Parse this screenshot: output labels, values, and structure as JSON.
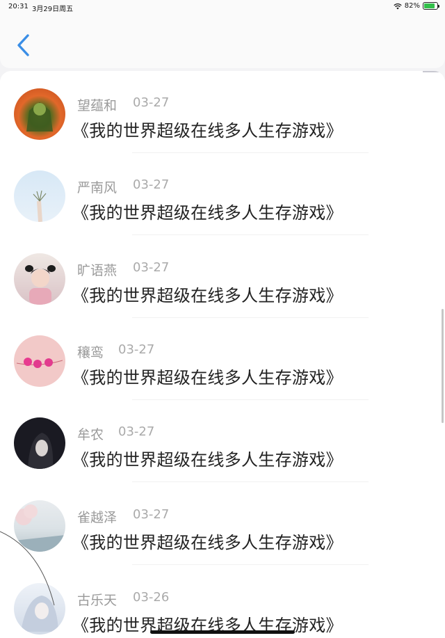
{
  "status_bar": {
    "time": "20:31",
    "date": "3月29日周五",
    "battery_percent": "82%",
    "battery_level": 0.82
  },
  "nav": {
    "back_icon": "chevron-left-icon",
    "accent": "#3a8ee6"
  },
  "items": [
    {
      "name": "望蕴和",
      "date": "03-27",
      "title": "《我的世界超级在线多人生存游戏》"
    },
    {
      "name": "严南风",
      "date": "03-27",
      "title": "《我的世界超级在线多人生存游戏》"
    },
    {
      "name": "旷语燕",
      "date": "03-27",
      "title": "《我的世界超级在线多人生存游戏》"
    },
    {
      "name": "穰鸾",
      "date": "03-27",
      "title": "《我的世界超级在线多人生存游戏》"
    },
    {
      "name": "牟农",
      "date": "03-27",
      "title": "《我的世界超级在线多人生存游戏》"
    },
    {
      "name": "雀越泽",
      "date": "03-27",
      "title": "《我的世界超级在线多人生存游戏》"
    },
    {
      "name": "古乐天",
      "date": "03-26",
      "title": "《我的世界超级在线多人生存游戏》"
    }
  ]
}
